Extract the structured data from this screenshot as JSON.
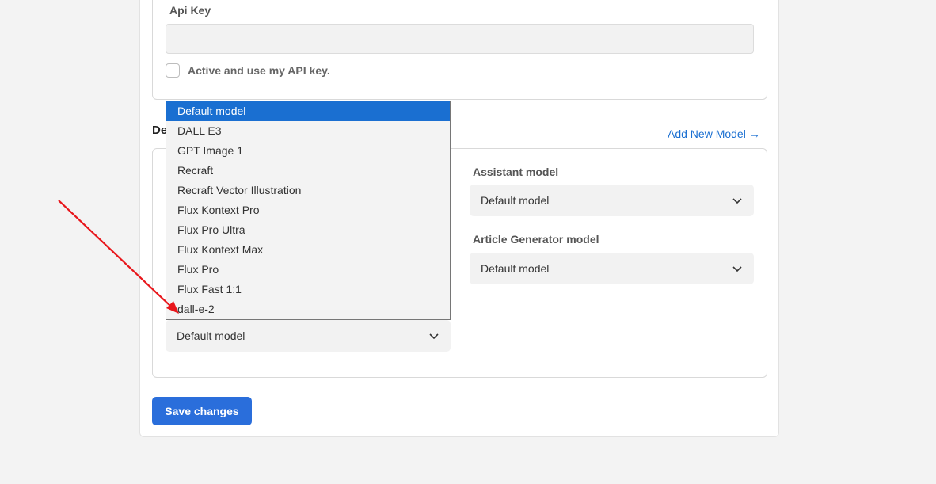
{
  "api_section": {
    "api_key_label": "Api Key",
    "api_key_value": "",
    "api_key_placeholder": "",
    "checkbox_label": "Active and use my API key.",
    "checkbox_checked": false
  },
  "models_section": {
    "title_visible_fragment": "De",
    "add_new_model_label": "Add New Model",
    "add_new_model_arrow": "→",
    "image_model_selected": "Default model",
    "assistant_model_label": "Assistant model",
    "assistant_model_selected": "Default model",
    "article_model_label": "Article Generator model",
    "article_model_selected": "Default model"
  },
  "dropdown": {
    "open": true,
    "highlighted": "Default model",
    "options": [
      "Default model",
      "DALL E3",
      "GPT Image 1",
      "Recraft",
      "Recraft Vector Illustration",
      "Flux Kontext Pro",
      "Flux Pro Ultra",
      "Flux Kontext Max",
      "Flux Pro",
      "Flux Fast 1:1",
      "dall-e-2"
    ]
  },
  "save_button_label": "Save changes",
  "colors": {
    "accent": "#2a6edb",
    "link": "#1a6fd1",
    "page_bg": "#f3f3f3",
    "annotation_arrow": "#e8161b"
  },
  "icons": {
    "select_chevron": "chevron-down-icon",
    "annotation": "red-arrow-annotation"
  }
}
